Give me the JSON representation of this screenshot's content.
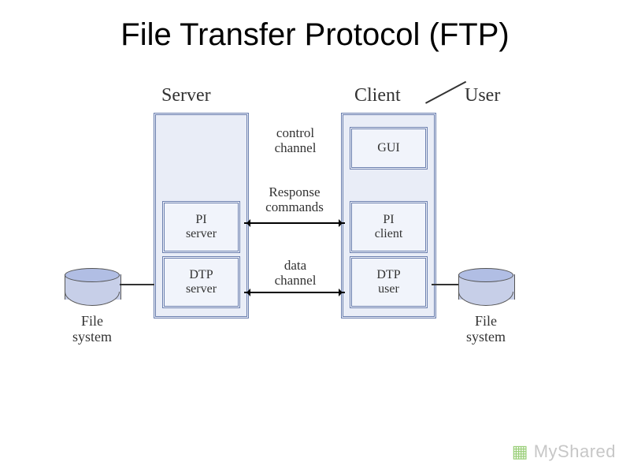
{
  "title": "File Transfer Protocol (FTP)",
  "labels": {
    "server": "Server",
    "client": "Client",
    "user": "User"
  },
  "boxes": {
    "pi_server": "PI\nserver",
    "dtp_server": "DTP\nserver",
    "gui": "GUI",
    "pi_client": "PI\nclient",
    "dtp_user": "DTP\nuser"
  },
  "connections": {
    "control": "control\nchannel",
    "response": "Response\ncommands",
    "data": "data\nchannel"
  },
  "filesystem": "File\nsystem",
  "watermark": "MyShared"
}
